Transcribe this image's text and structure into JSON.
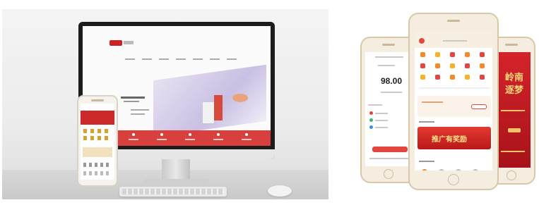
{
  "left_phone_panel": {
    "balance": "98.00"
  },
  "center_phone": {
    "banner_text": "推广有奖励"
  },
  "right_poster": {
    "line1": "岭南",
    "line2": "逐梦"
  },
  "colors": {
    "brand_red": "#d8403e",
    "gold": "#f6d47a"
  }
}
